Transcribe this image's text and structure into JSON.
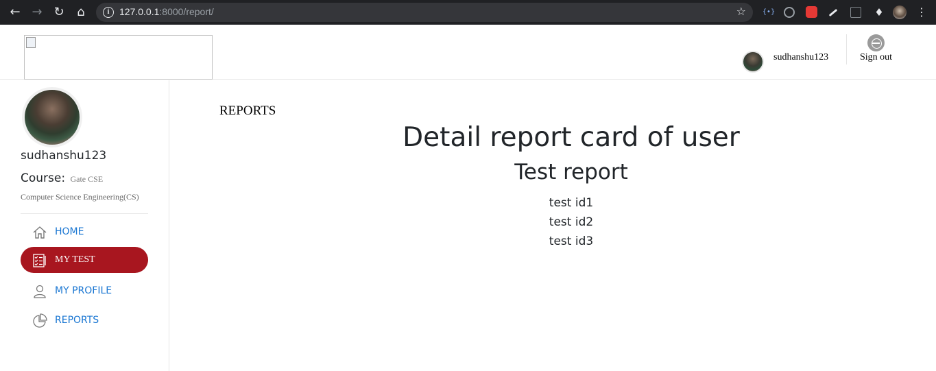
{
  "browser": {
    "url_host": "127.0.0.1",
    "url_path": ":8000/report/"
  },
  "header": {
    "username": "sudhanshu123",
    "signout_label": "Sign out"
  },
  "sidebar": {
    "username": "sudhanshu123",
    "course_label": "Course:",
    "course_value": "Gate CSE",
    "branch": "Computer Science Engineering(CS)",
    "menu": [
      {
        "label": "HOME",
        "icon": "home-icon",
        "active": false
      },
      {
        "label": "MY TEST",
        "icon": "checklist-icon",
        "active": true
      },
      {
        "label": "MY PROFILE",
        "icon": "user-icon",
        "active": false
      },
      {
        "label": "REPORTS",
        "icon": "pie-chart-icon",
        "active": false
      }
    ]
  },
  "main": {
    "section_title": "REPORTS",
    "heading": "Detail report card of user",
    "subheading": "Test report",
    "tests": [
      "test id1",
      "test id2",
      "test id3"
    ]
  },
  "colors": {
    "active_menu": "#a8161f",
    "link": "#1976d2"
  }
}
